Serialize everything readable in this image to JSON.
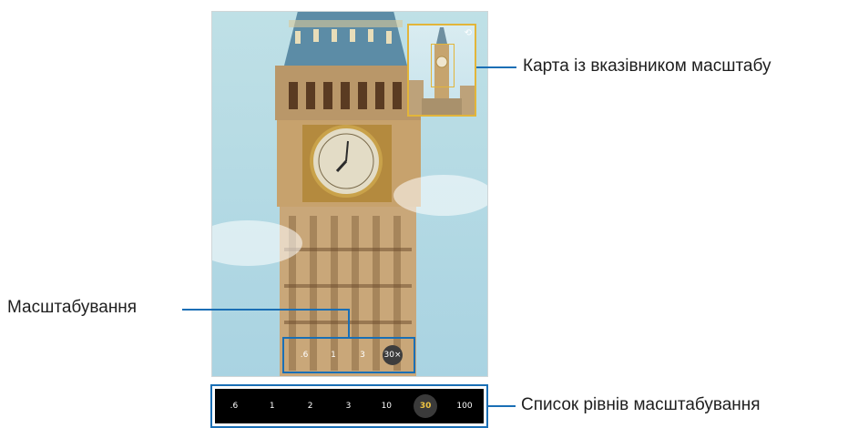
{
  "callouts": {
    "map": "Карта із вказівником масштабу",
    "zoom": "Масштабування",
    "levels": "Список рівнів масштабування"
  },
  "zoom_shortcuts": [
    ".6",
    "1",
    "3",
    "30×"
  ],
  "zoom_levels": [
    ".6",
    "1",
    "2",
    "3",
    "10",
    "30",
    "100"
  ],
  "selected_level": "30",
  "colors": {
    "accent": "#1a6fb5",
    "highlight": "#e2b53a",
    "active_level": "#f0c542"
  },
  "icons": [
    "camera-flip-icon"
  ]
}
